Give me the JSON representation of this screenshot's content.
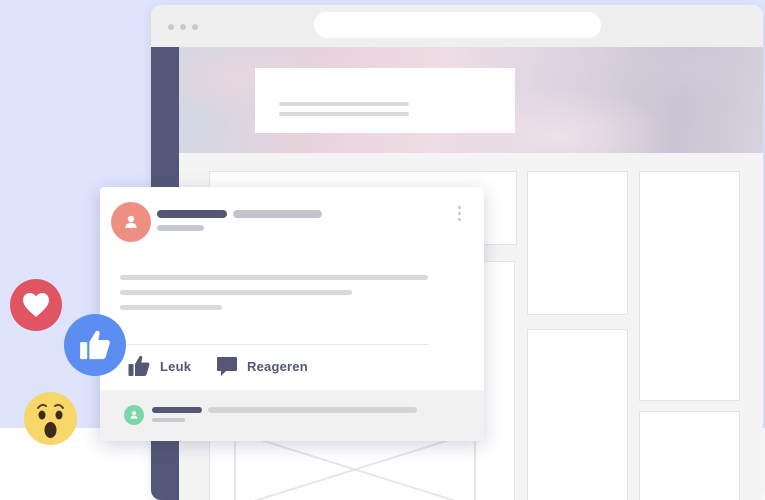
{
  "post": {
    "actions": {
      "like_label": "Leuk",
      "comment_label": "Reageren"
    }
  },
  "reactions": [
    {
      "icon": "heart-icon",
      "color": "#e05463"
    },
    {
      "icon": "thumbs-up-icon",
      "color": "#5b8ef0"
    },
    {
      "icon": "wow-face-icon",
      "color": "#f7d76a"
    }
  ],
  "colors": {
    "background_panel": "#dfe3fc",
    "sidebar_strip": "#545775",
    "user_avatar": "#ef8f83",
    "commenter_avatar": "#7bd6a9",
    "action_text": "#545775"
  }
}
